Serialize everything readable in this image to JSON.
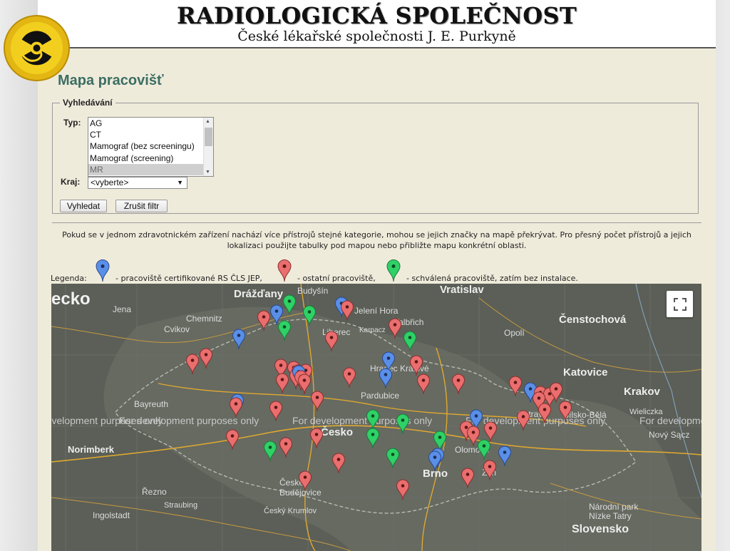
{
  "header": {
    "title": "RADIOLOGICKÁ SPOLEČNOST",
    "subtitle": "České lékařské společnosti J. E. Purkyně",
    "logo_icon": "radiation-trefoil-icon"
  },
  "page_title": "Mapa pracovišť",
  "search": {
    "legend": "Vyhledávání",
    "type_label": "Typ:",
    "type_options": [
      "AG",
      "CT",
      "Mamograf (bez screeningu)",
      "Mamograf (screening)",
      "MR"
    ],
    "type_selected": "MR",
    "region_label": "Kraj:",
    "region_value": "<vyberte>",
    "search_button": "Vyhledat",
    "cancel_button": "Zrušit filtr"
  },
  "note": "Pokud se v jednom zdravotnickém zařízení nachází více přístrojů stejné kategorie, mohou se jejich značky na mapě překrývat. Pro přesný počet přístrojů a jejich lokalizaci použijte tabulky pod mapou nebo přibližte mapu konkrétní oblasti.",
  "legend": {
    "label": "Legenda:",
    "blue_text": "- pracoviště certifikované RS ČLS JEP,",
    "red_text": "- ostatní pracoviště,",
    "green_text": "- schválená pracoviště, zatím bez instalace.",
    "colors": {
      "blue": "#5a8fe8",
      "red": "#ea6e6e",
      "green": "#2fd166"
    }
  },
  "map": {
    "watermark": "For development purposes only",
    "fullscreen_icon": "fullscreen-icon",
    "labels": {
      "ecko": "ecko",
      "drazdany": "Drážďany",
      "budysin": "Budyšín",
      "vratislav": "Vratislav",
      "jena": "Jena",
      "chemnitz": "Chemnitz",
      "jelenia": "Jelení Hora",
      "valbrich": "Valbřich",
      "czestochowa": "Čenstochová",
      "cvikov": "Cvikov",
      "liberec": "Liberec",
      "karpacz": "Karpacz",
      "opoli": "Opolí",
      "hradec": "Hradec Králové",
      "pardubice": "Pardubice",
      "katovice": "Katovice",
      "krakov": "Krakov",
      "bayreuth": "Bayreuth",
      "ostrava": "Ostrava",
      "bielsko": "Bílsko-Bělá",
      "wieliczka": "Wieliczka",
      "novysacz": "Nový Sącz",
      "norimberk": "Norimberk",
      "cesko": "Česko",
      "olomouc": "Olomouc",
      "zlin": "Zlín",
      "brno": "Brno",
      "rezno": "Řezno",
      "budejovice": "České Budějovice",
      "ingolstadt": "Ingolstadt",
      "straubing": "Straubing",
      "krumlov": "Český Krumlov",
      "narodni": "Národní park",
      "tatry": "Nízke Tatry",
      "slovensko": "Slovensko"
    }
  }
}
